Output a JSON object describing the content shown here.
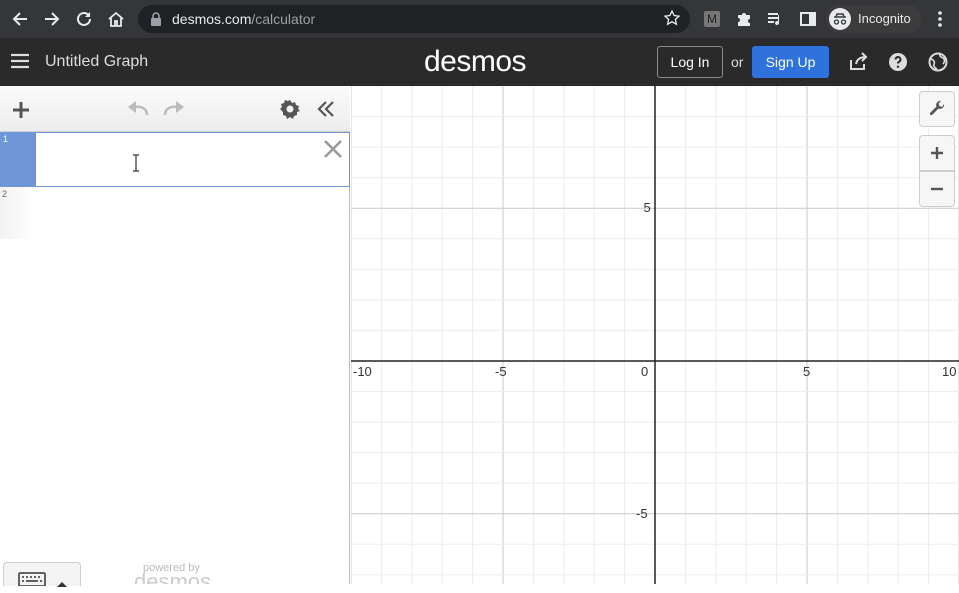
{
  "browser": {
    "url_domain": "desmos.com",
    "url_path": "/calculator",
    "extension_badge": "M",
    "incognito_label": "Incognito"
  },
  "header": {
    "title": "Untitled Graph",
    "logo": "desmos",
    "login_label": "Log In",
    "or_label": "or",
    "signup_label": "Sign Up"
  },
  "expressions": {
    "rows": [
      {
        "index": "1",
        "value": ""
      },
      {
        "index": "2",
        "value": ""
      }
    ],
    "powered_by": "powered by",
    "powered_brand": "desmos"
  },
  "graph": {
    "x_ticks": [
      "-10",
      "-5",
      "0",
      "5",
      "10"
    ],
    "y_ticks": [
      "5",
      "-5"
    ],
    "x_range": [
      -10,
      10
    ],
    "y_range": [
      -7.3,
      9
    ]
  },
  "colors": {
    "header_bg": "#2a2a2a",
    "accent_blue": "#2f72dc",
    "expression_focus": "#6f96d8"
  },
  "icons": [
    "back-icon",
    "forward-icon",
    "reload-icon",
    "home-icon",
    "lock-icon",
    "star-icon",
    "puzzle-icon",
    "media-icon",
    "sidepanel-icon",
    "incognito-icon",
    "menu-dots-icon",
    "hamburger-icon",
    "share-icon",
    "help-icon",
    "globe-icon",
    "plus-icon",
    "undo-icon",
    "redo-icon",
    "gear-icon",
    "collapse-icon",
    "close-icon",
    "keyboard-icon",
    "wrench-icon",
    "zoom-in-icon",
    "zoom-out-icon"
  ]
}
